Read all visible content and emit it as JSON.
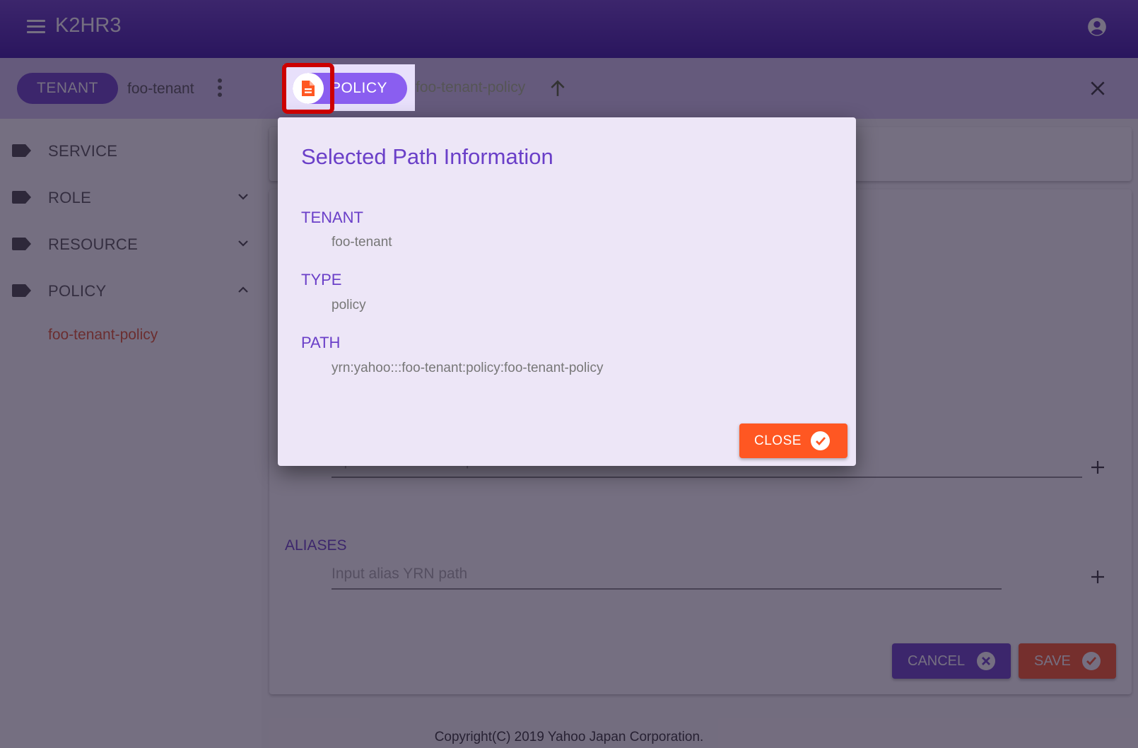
{
  "app": {
    "title": "K2HR3",
    "icons": {
      "menu": "menu-icon",
      "account": "account-circle-icon"
    }
  },
  "toolbar": {
    "tenant_chip": "TENANT",
    "tenant_name": "foo-tenant",
    "policy_chip": "POLICY",
    "policy_name": "foo-tenant-policy",
    "icons": {
      "more": "kebab-vertical-icon",
      "policy_doc": "document-icon",
      "up": "arrow-up-icon",
      "close": "close-icon"
    }
  },
  "sidebar": {
    "items": [
      {
        "label": "SERVICE",
        "expandable": false
      },
      {
        "label": "ROLE",
        "expandable": true,
        "expanded": false
      },
      {
        "label": "RESOURCE",
        "expandable": true,
        "expanded": false
      },
      {
        "label": "POLICY",
        "expandable": true,
        "expanded": true
      }
    ],
    "sub_items": [
      {
        "label": "foo-tenant-policy",
        "selected": true
      }
    ]
  },
  "main": {
    "resource_field": {
      "placeholder": "Input resource YRN path"
    },
    "aliases": {
      "label": "ALIASES",
      "placeholder": "Input alias YRN path"
    },
    "buttons": {
      "cancel": "CANCEL",
      "save": "SAVE"
    }
  },
  "dialog": {
    "title": "Selected Path Information",
    "fields": [
      {
        "key": "TENANT",
        "value": "foo-tenant"
      },
      {
        "key": "TYPE",
        "value": "policy"
      },
      {
        "key": "PATH",
        "value": "yrn:yahoo:::foo-tenant:policy:foo-tenant-policy"
      }
    ],
    "close_label": "CLOSE"
  },
  "footer": {
    "copyright": "Copyright(C) 2019 Yahoo Japan Corporation."
  },
  "colors": {
    "primary": "#6a3fc8",
    "accent": "#ff5722",
    "highlight": "#cc0000"
  }
}
